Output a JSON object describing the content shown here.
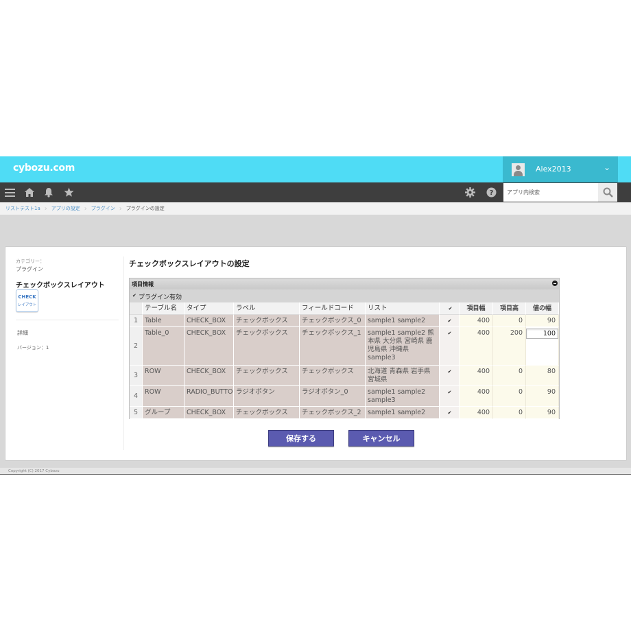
{
  "app": {
    "logo": "cybozu.com",
    "user_name": "Alex2013"
  },
  "nav": {
    "icons": [
      "menu-icon",
      "home-icon",
      "bell-icon",
      "star-icon",
      "gear-icon",
      "help-icon",
      "search-icon"
    ],
    "search_placeholder": "アプリ内検索"
  },
  "breadcrumb": [
    "リストテスト1a",
    "アプリの設定",
    "プラグイン",
    "プラグインの設定"
  ],
  "sidebar": {
    "category_label": "カテゴリー：",
    "category_value": "プラグイン",
    "plugin_name": "チェックボックスレイアウト",
    "icon_line1": "CHECK",
    "icon_line2": "レイアウト",
    "detail_link": "詳細",
    "version": "バージョン：1"
  },
  "main": {
    "title": "チェックボックスレイアウトの設定",
    "section_title": "項目情報",
    "enable_check": "✔",
    "enable_label": "プラグイン有効",
    "columns": [
      "",
      "テーブル名",
      "タイプ",
      "ラベル",
      "フィールドコード",
      "リスト",
      "✔",
      "項目幅",
      "項目高",
      "値の幅"
    ],
    "rows": [
      {
        "idx": "1",
        "table": "Table",
        "type": "CHECK_BOX",
        "label": "チェックボックス",
        "code": "チェックボックス_0",
        "list": "sample1 sample2",
        "check": "✔",
        "w": "400",
        "h": "0",
        "vw": "90"
      },
      {
        "idx": "2",
        "table": "Table_0",
        "type": "CHECK_BOX",
        "label": "チェックボックス",
        "code": "チェックボックス_1",
        "list": "sample1 sample2 熊本県 大分県 宮崎県 鹿児島県 沖縄県 sample3",
        "check": "✔",
        "w": "400",
        "h": "200",
        "vw": "100"
      },
      {
        "idx": "3",
        "table": "ROW",
        "type": "CHECK_BOX",
        "label": "チェックボックス",
        "code": "チェックボックス",
        "list": "北海道 青森県 岩手県 宮城県",
        "check": "✔",
        "w": "400",
        "h": "0",
        "vw": "80"
      },
      {
        "idx": "4",
        "table": "ROW",
        "type": "RADIO_BUTTON",
        "label": "ラジオボタン",
        "code": "ラジオボタン_0",
        "list": "sample1 sample2 sample3",
        "check": "✔",
        "w": "400",
        "h": "0",
        "vw": "90"
      },
      {
        "idx": "5",
        "table": "グループ",
        "type": "CHECK_BOX",
        "label": "チェックボックス",
        "code": "チェックボックス_2",
        "list": "sample1 sample2",
        "check": "✔",
        "w": "400",
        "h": "0",
        "vw": "90"
      }
    ],
    "editing_row": 1
  },
  "buttons": {
    "save": "保存する",
    "cancel": "キャンセル"
  },
  "footer": "Copyright (C) 2017 Cybozu",
  "colors": {
    "header": "#4fdcf5",
    "user_box": "#3ab9cf",
    "navbar": "#3e3e3e",
    "row_shade": "#d9ceca",
    "number_cell": "#fcfaeb",
    "button": "#5b5bb0"
  }
}
